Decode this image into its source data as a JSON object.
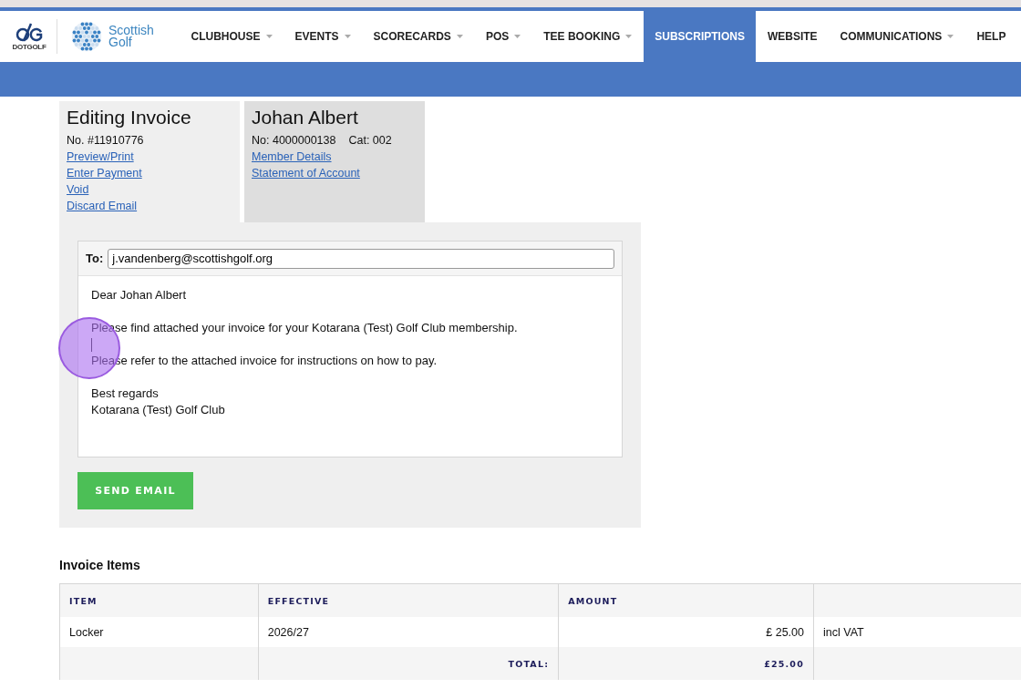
{
  "brand": {
    "dotgolf_label": "DOTGOLF",
    "partner_name": [
      "Scottish",
      "Golf"
    ]
  },
  "nav": [
    {
      "label": "CLUBHOUSE",
      "dropdown": true,
      "selected": false
    },
    {
      "label": "EVENTS",
      "dropdown": true,
      "selected": false
    },
    {
      "label": "SCORECARDS",
      "dropdown": true,
      "selected": false
    },
    {
      "label": "POS",
      "dropdown": true,
      "selected": false
    },
    {
      "label": "TEE BOOKING",
      "dropdown": true,
      "selected": false
    },
    {
      "label": "SUBSCRIPTIONS",
      "dropdown": false,
      "selected": true
    },
    {
      "label": "WEBSITE",
      "dropdown": false,
      "selected": false
    },
    {
      "label": "COMMUNICATIONS",
      "dropdown": true,
      "selected": false
    },
    {
      "label": "HELP",
      "dropdown": false,
      "selected": false
    }
  ],
  "invoice_panel": {
    "title": "Editing Invoice",
    "number": "No. #11910776",
    "links": [
      "Preview/Print",
      "Enter Payment",
      "Void",
      "Discard Email"
    ]
  },
  "member_panel": {
    "name": "Johan Albert",
    "member_no": "No: 4000000138",
    "category": "Cat: 002",
    "links": [
      "Member Details",
      "Statement of Account"
    ]
  },
  "email": {
    "to_label": "To:",
    "to_value": "j.vandenberg@scottishgolf.org",
    "paragraphs": [
      {
        "lines": [
          "Dear Johan Albert"
        ],
        "cursor_after": false
      },
      {
        "lines": [
          "Please find attached your invoice for your Kotarana (Test) Golf Club membership."
        ],
        "cursor_after": true
      },
      {
        "lines": [
          "Please refer to the attached invoice for instructions on how to pay."
        ],
        "cursor_after": false
      },
      {
        "lines": [
          "Best regards",
          "Kotarana (Test) Golf Club"
        ],
        "cursor_after": false
      }
    ],
    "send_button": "SEND EMAIL"
  },
  "click_marker": true,
  "invoice_items": {
    "title": "Invoice Items",
    "columns": [
      "ITEM",
      "EFFECTIVE",
      "AMOUNT"
    ],
    "rows": [
      {
        "item": "Locker",
        "effective": "2026/27",
        "amount": "£ 25.00",
        "note": "incl VAT"
      }
    ],
    "total_label": "TOTAL:",
    "total_value": "£25.00"
  }
}
